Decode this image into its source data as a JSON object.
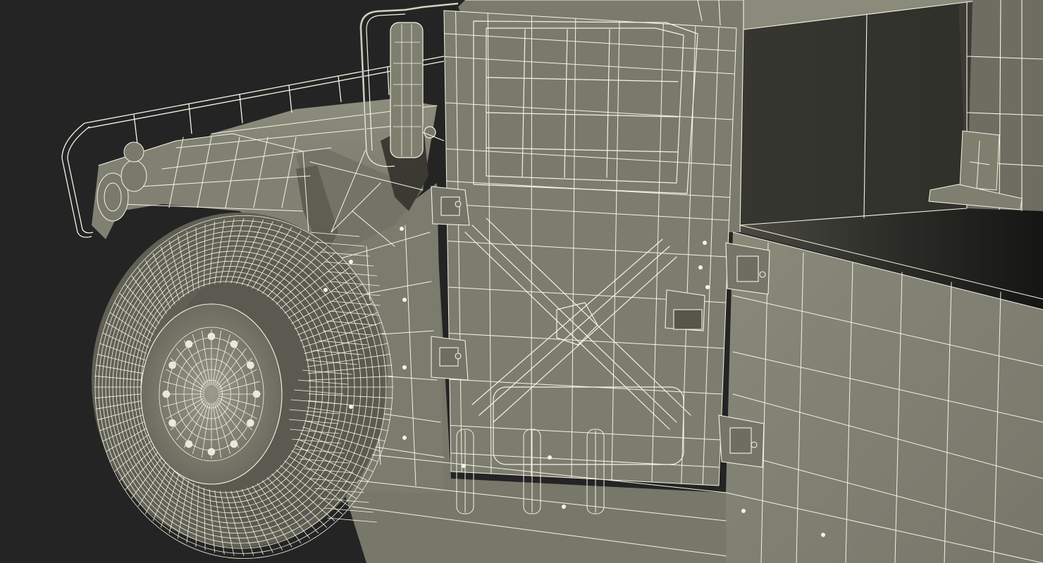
{
  "scene": {
    "subject": "humvee-wireframe-render",
    "palette": {
      "background": "#242424",
      "body_fill": "#7f7f70",
      "body_fill_dark": "#6a6a5d",
      "body_fill_light": "#8c8c7d",
      "interior": "#1d1d1b",
      "interior_mid": "#3a3a33",
      "wire": "#f4f4e6",
      "tire": "#5e5e53",
      "rim": "#8a8a7b"
    },
    "icons": {
      "vehicle": "humvee-icon",
      "wheel": "wheel-icon",
      "mirror": "side-mirror-icon",
      "door": "door-icon",
      "hinge": "door-hinge-icon"
    }
  }
}
